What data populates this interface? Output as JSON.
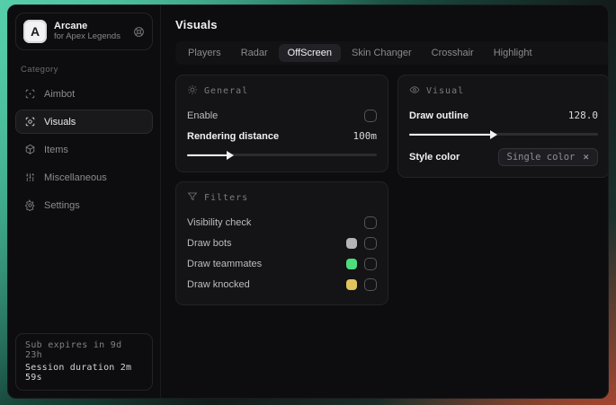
{
  "brand": {
    "initial": "A",
    "name": "Arcane",
    "subtitle": "for Apex Legends"
  },
  "sidebar": {
    "category_label": "Category",
    "items": [
      {
        "label": "Aimbot",
        "icon": "crosshair-icon",
        "active": false
      },
      {
        "label": "Visuals",
        "icon": "scan-eye-icon",
        "active": true
      },
      {
        "label": "Items",
        "icon": "cube-icon",
        "active": false
      },
      {
        "label": "Miscellaneous",
        "icon": "sliders-icon",
        "active": false
      },
      {
        "label": "Settings",
        "icon": "gear-icon",
        "active": false
      }
    ],
    "footer": {
      "sub_expires": "Sub expires in 9d 23h",
      "session_duration": "Session duration 2m 59s"
    }
  },
  "header": {
    "title": "Visuals"
  },
  "tabs": [
    {
      "label": "Players",
      "active": false
    },
    {
      "label": "Radar",
      "active": false
    },
    {
      "label": "OffScreen",
      "active": true
    },
    {
      "label": "Skin Changer",
      "active": false
    },
    {
      "label": "Crosshair",
      "active": false
    },
    {
      "label": "Highlight",
      "active": false
    }
  ],
  "panels": {
    "general": {
      "title": "General",
      "enable_label": "Enable",
      "enable_checked": false,
      "rendering": {
        "label": "Rendering distance",
        "value": "100m",
        "fill": "22%"
      }
    },
    "visual": {
      "title": "Visual",
      "outline": {
        "label": "Draw outline",
        "value": "128.0",
        "fill": "44%"
      },
      "style_color": {
        "label": "Style color",
        "selected": "Single color",
        "close_glyph": "✕"
      }
    },
    "filters": {
      "title": "Filters",
      "rows": [
        {
          "label": "Visibility check",
          "swatch": null,
          "checked": false
        },
        {
          "label": "Draw bots",
          "swatch": "#b5b5b8",
          "checked": false
        },
        {
          "label": "Draw teammates",
          "swatch": "#4fdc7d",
          "checked": false
        },
        {
          "label": "Draw knocked",
          "swatch": "#e3c45c",
          "checked": false
        }
      ]
    }
  },
  "colors": {
    "accent_teal": "#46c2a0",
    "accent_red": "#d1462b",
    "window_bg": "#0d0d0f"
  }
}
